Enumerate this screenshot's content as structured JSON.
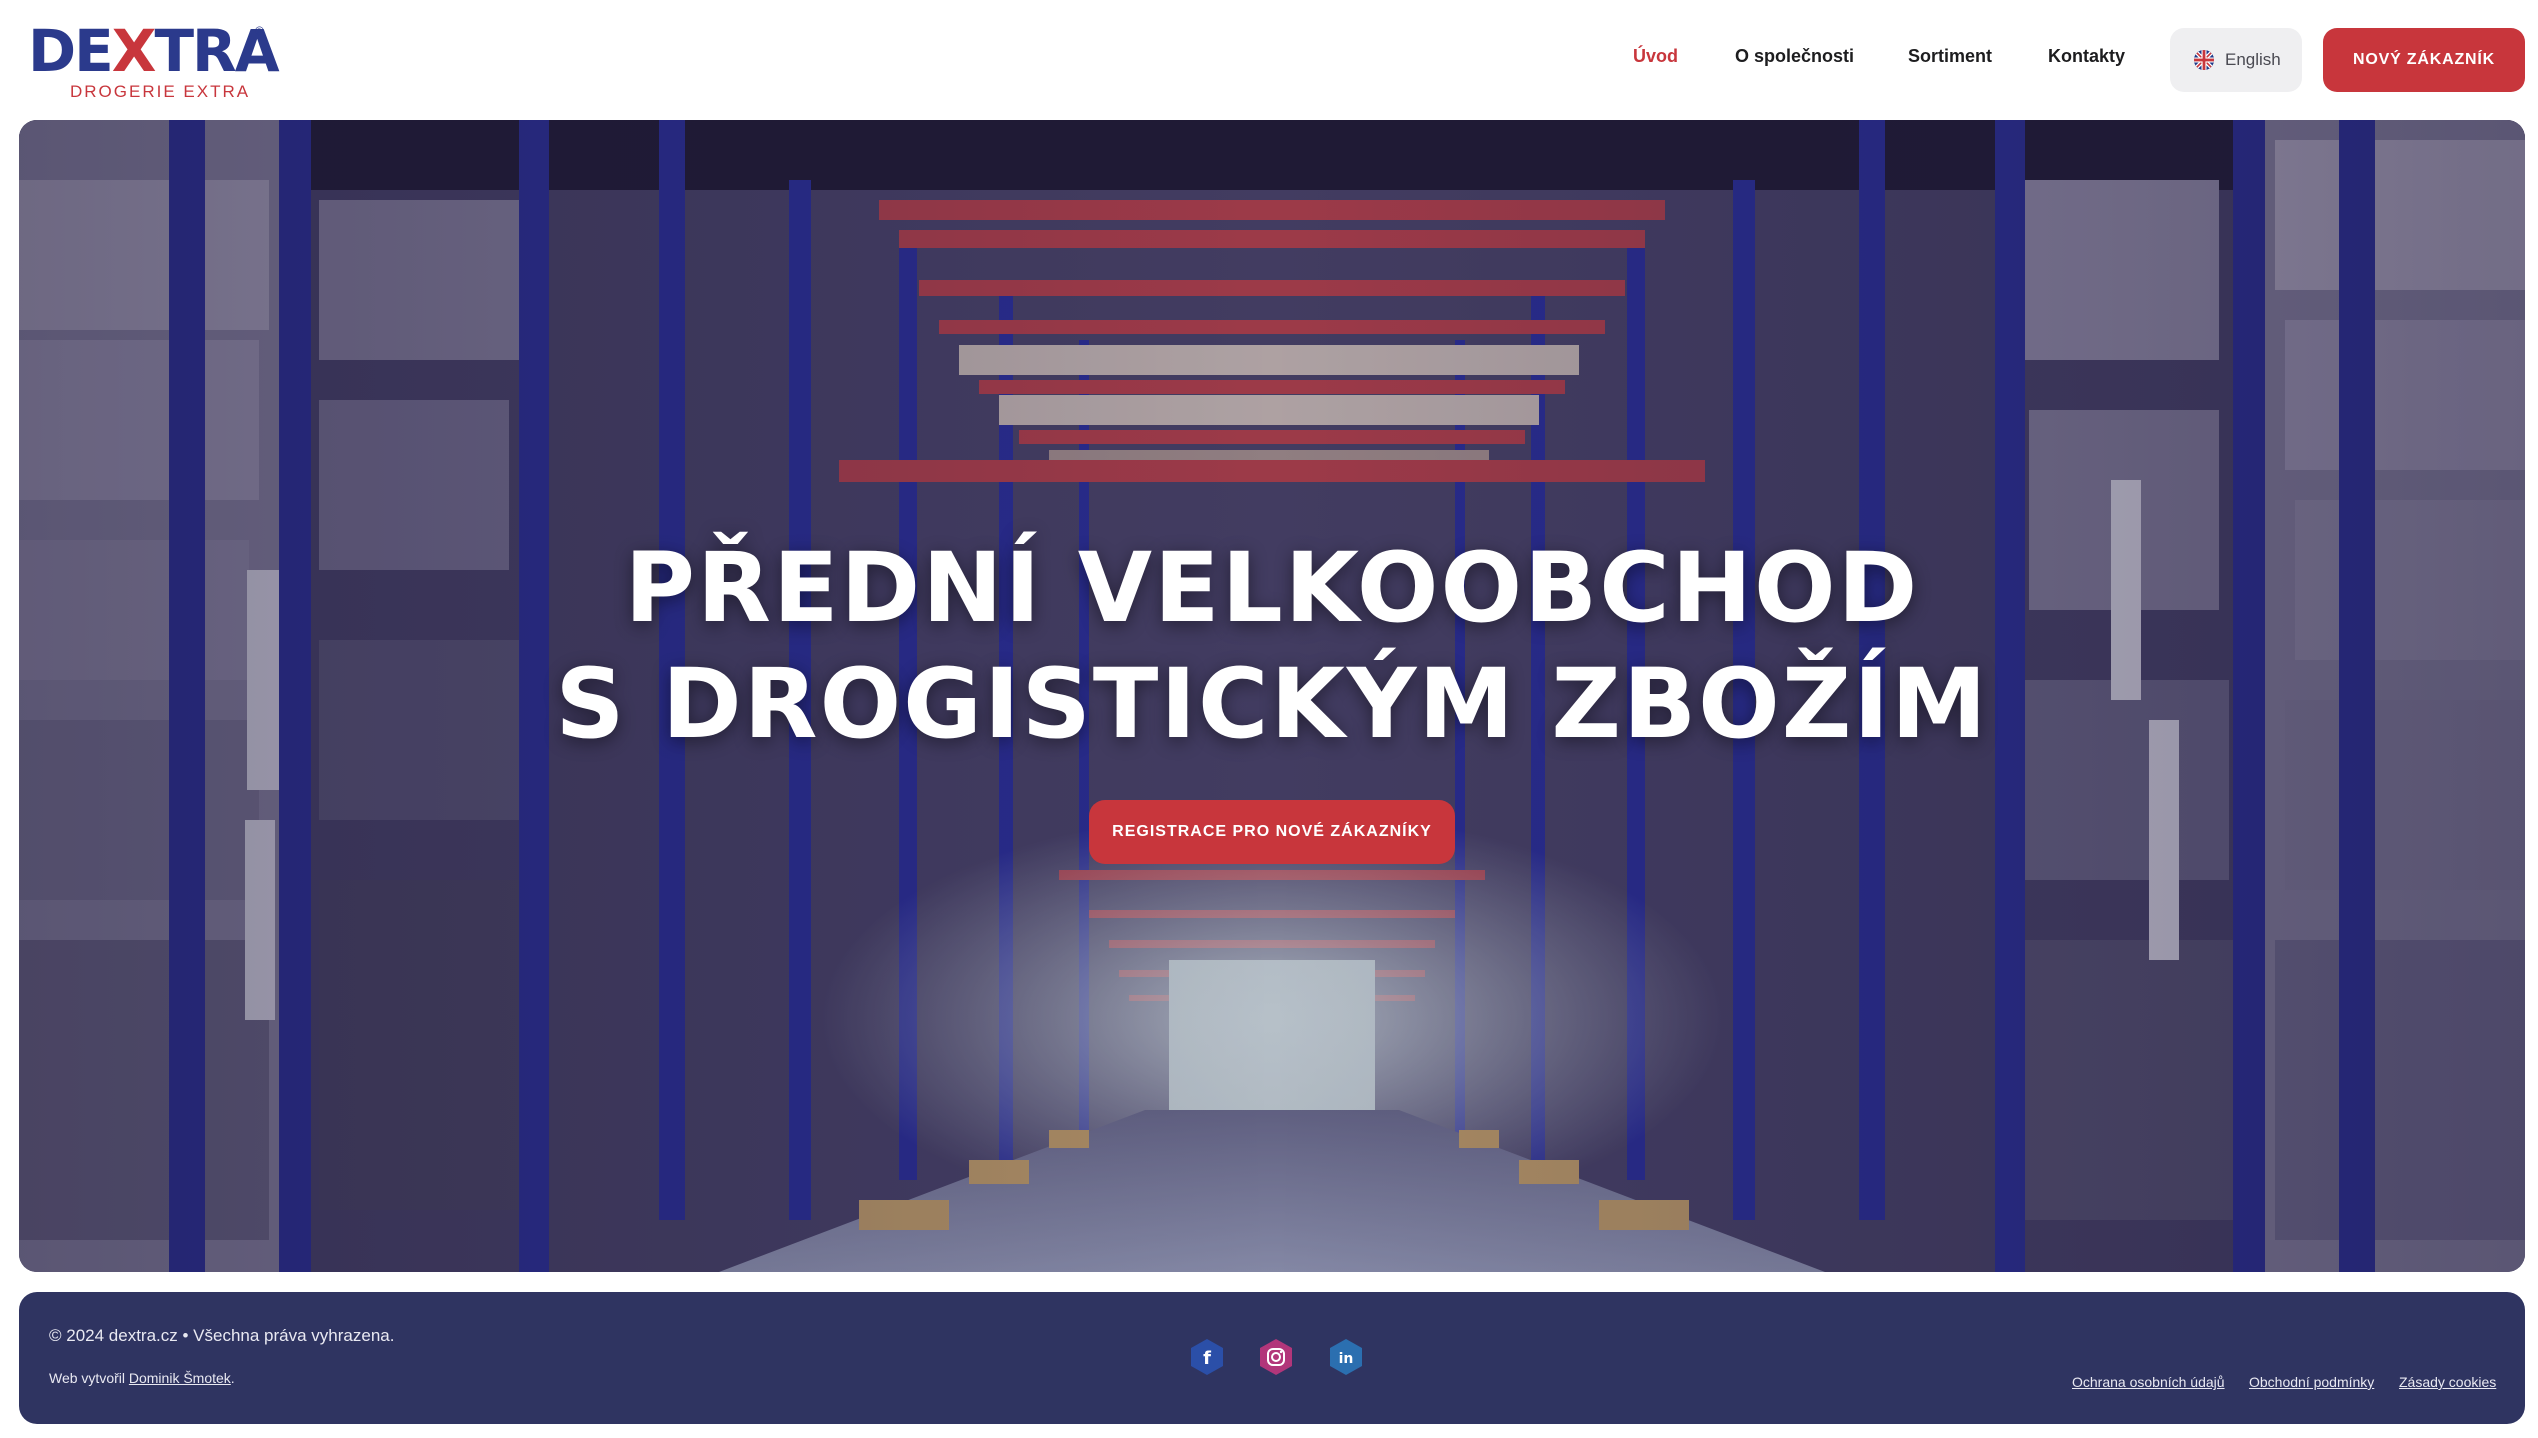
{
  "brand": {
    "logo_pre": "DE",
    "logo_x": "X",
    "logo_post": "TRA",
    "logo_reg": "®",
    "tagline": "DROGERIE EXTRA"
  },
  "nav": {
    "items": [
      {
        "label": "Úvod",
        "active": true
      },
      {
        "label": "O společnosti",
        "active": false
      },
      {
        "label": "Sortiment",
        "active": false
      },
      {
        "label": "Kontakty",
        "active": false
      }
    ],
    "language_label": "English",
    "cta_label": "NOVÝ ZÁKAZNÍK"
  },
  "hero": {
    "title_line1": "PŘEDNÍ VELKOOBCHOD",
    "title_line2": "S DROGISTICKÝM ZBOŽÍM",
    "button_label": "REGISTRACE PRO NOVÉ ZÁKAZNÍKY"
  },
  "footer": {
    "copyright": "© 2024 dextra.cz • Všechna práva vyhrazena.",
    "credit_prefix": "Web vytvořil ",
    "credit_link": "Dominik Šmotek",
    "credit_suffix": ".",
    "social": [
      {
        "icon": "facebook-icon",
        "glyph": "f"
      },
      {
        "icon": "instagram-icon",
        "glyph": "◎"
      },
      {
        "icon": "linkedin-icon",
        "glyph": "in"
      }
    ],
    "legal_links": [
      "Ochrana osobních údajů",
      "Obchodní podmínky",
      "Zásady cookies"
    ]
  },
  "colors": {
    "accent_red": "#c8363c",
    "brand_blue": "#2b3a8c",
    "footer_bg": "#2f3461"
  }
}
